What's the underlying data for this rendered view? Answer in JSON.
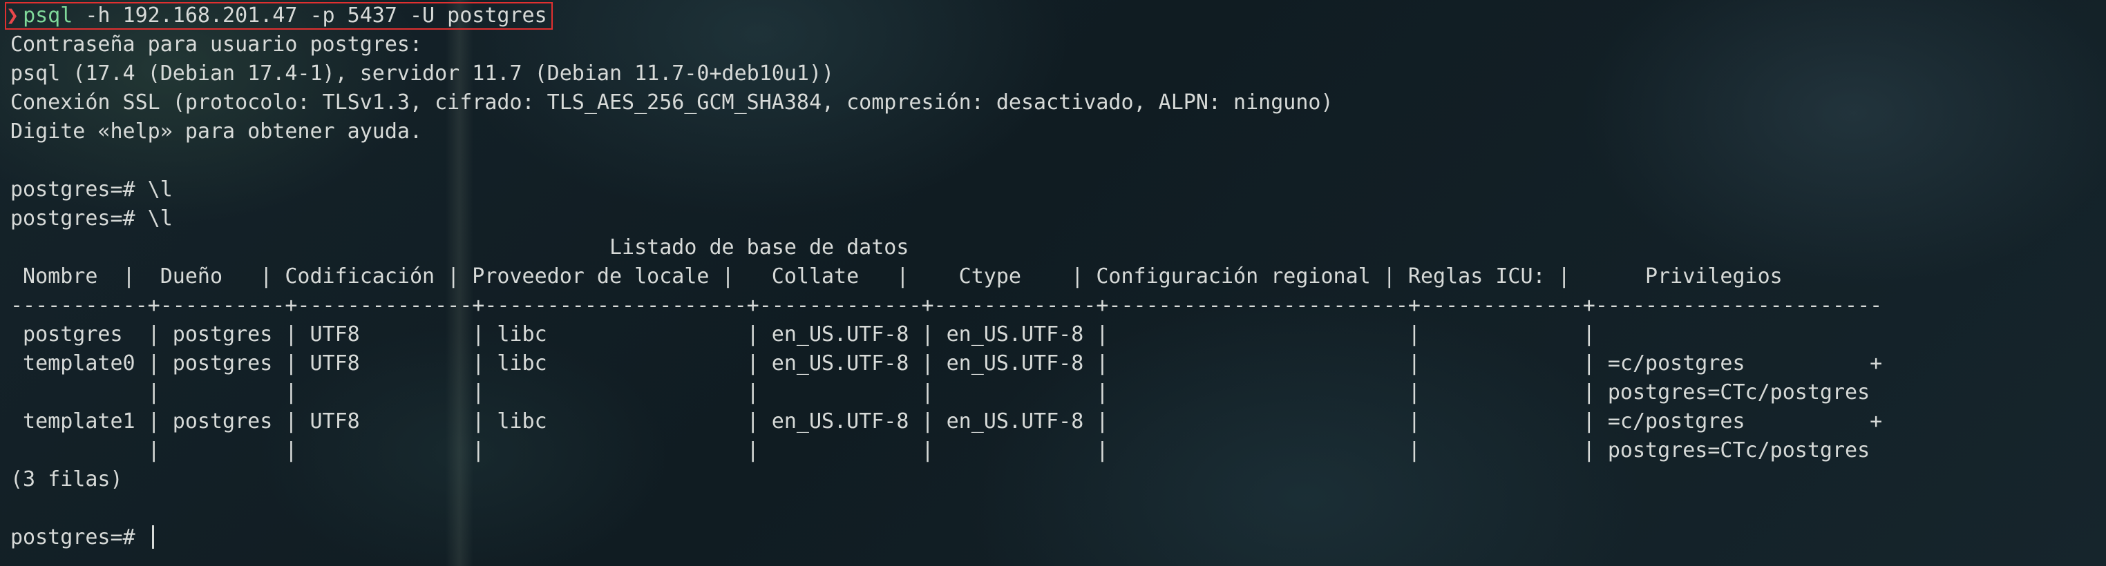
{
  "command": {
    "prompt_symbol": "❯",
    "name": "psql",
    "args": " -h 192.168.201.47 -p 5437 -U postgres"
  },
  "banner_lines": [
    "Contraseña para usuario postgres:",
    "psql (17.4 (Debian 17.4-1), servidor 11.7 (Debian 11.7-0+deb10u1))",
    "Conexión SSL (protocolo: TLSv1.3, cifrado: TLS_AES_256_GCM_SHA384, compresión: desactivado, ALPN: ninguno)",
    "Digite «help» para obtener ayuda."
  ],
  "history_lines": [
    "postgres=# \\l",
    "postgres=# \\l"
  ],
  "table": {
    "title": "                                                Listado de base de datos",
    "header": " Nombre  |  Dueño   | Codificación | Proveedor de locale |   Collate   |    Ctype    | Configuración regional | Reglas ICU: |      Privilegios",
    "separator": "-----------+----------+--------------+---------------------+-------------+-------------+------------------------+-------------+-----------------------",
    "rows": [
      " postgres  | postgres | UTF8         | libc                | en_US.UTF-8 | en_US.UTF-8 |                        |             |",
      " template0 | postgres | UTF8         | libc                | en_US.UTF-8 | en_US.UTF-8 |                        |             | =c/postgres          +",
      "           |          |              |                     |             |             |                        |             | postgres=CTc/postgres",
      " template1 | postgres | UTF8         | libc                | en_US.UTF-8 | en_US.UTF-8 |                        |             | =c/postgres          +",
      "           |          |              |                     |             |             |                        |             | postgres=CTc/postgres"
    ],
    "footer": "(3 filas)"
  },
  "final_prompt": "postgres=# "
}
